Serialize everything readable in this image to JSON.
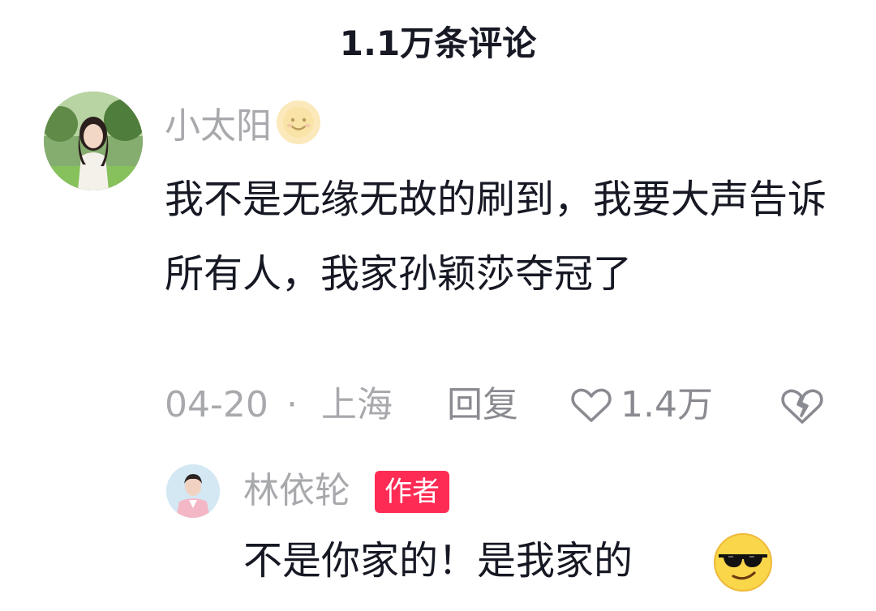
{
  "header": {
    "title": "1.1万条评论"
  },
  "comment": {
    "username": "小太阳",
    "badge_icon": "sun-emoji",
    "text": "我不是无缘无故的刷到，我要大声告诉所有人，我家孙颖莎夺冠了",
    "date": "04-20",
    "separator": "·",
    "location": "上海",
    "reply_label": "回复",
    "like_count": "1.4万",
    "like_icon": "heart-outline-icon",
    "dislike_icon": "broken-heart-icon"
  },
  "reply": {
    "username": "林依轮",
    "author_badge": "作者",
    "text": "不是你家的！是我家的",
    "trailing_emoji": "sunglasses-emoji"
  },
  "colors": {
    "primary_text": "#161823",
    "secondary_text": "#a8a9ad",
    "author_badge_bg": "#fe2c55"
  }
}
